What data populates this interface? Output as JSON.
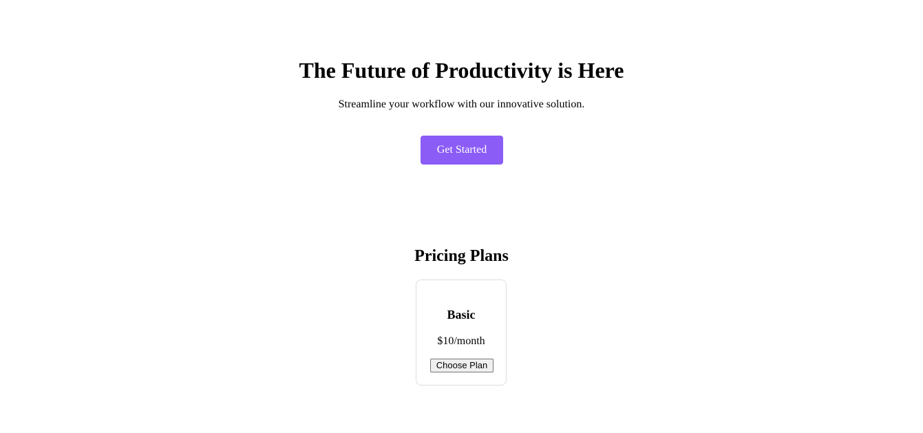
{
  "hero": {
    "title": "The Future of Productivity is Here",
    "subtitle": "Streamline your workflow with our innovative solution.",
    "cta_label": "Get Started",
    "cta_color": "#8b5cf6"
  },
  "pricing": {
    "title": "Pricing Plans",
    "plans": [
      {
        "name": "Basic",
        "price": "$10/month",
        "button_label": "Choose Plan"
      }
    ]
  }
}
